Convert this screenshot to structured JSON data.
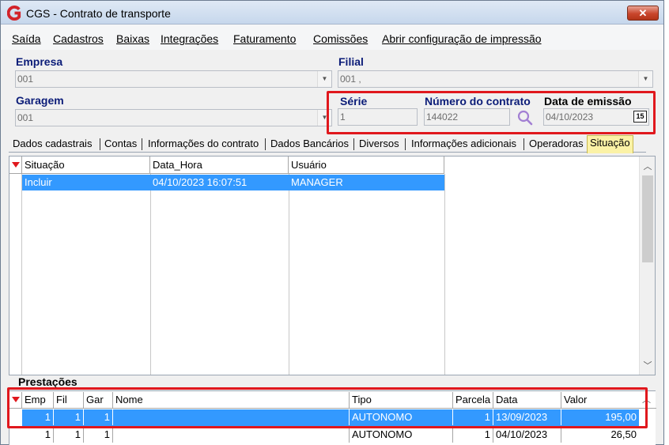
{
  "window": {
    "title": "CGS - Contrato de transporte",
    "close_label": "✕"
  },
  "menu": [
    "Saída",
    "Cadastros",
    "Baixas",
    "Integrações",
    "Faturamento",
    "Comissões",
    "Abrir configuração de impressão"
  ],
  "form": {
    "empresa_label": "Empresa",
    "empresa_value": "001",
    "filial_label": "Filial",
    "filial_value": "001 ,",
    "garagem_label": "Garagem",
    "garagem_value": "001",
    "serie_label": "Série",
    "serie_value": "1",
    "numero_label": "Número do contrato",
    "numero_value": "144022",
    "data_label": "Data de emissão",
    "data_value": "04/10/2023",
    "calendar_icon_text": "15"
  },
  "tabs": [
    "Dados cadastrais",
    "Contas",
    "Informações do contrato",
    "Dados Bancários",
    "Diversos",
    "Informações adicionais",
    "Operadoras",
    "Situação"
  ],
  "situacao_grid": {
    "headers": [
      "Situação",
      "Data_Hora",
      "Usuário"
    ],
    "rows": [
      [
        "Incluir",
        "04/10/2023 16:07:51",
        "MANAGER"
      ]
    ]
  },
  "prestacoes": {
    "label": "Prestações",
    "headers": [
      "Emp",
      "Fil",
      "Gar",
      "Nome",
      "Tipo",
      "Parcela",
      "Data",
      "Valor"
    ],
    "rows": [
      [
        "1",
        "1",
        "1",
        "",
        "AUTONOMO",
        "1",
        "13/09/2023",
        "195,00"
      ],
      [
        "1",
        "1",
        "1",
        "",
        "AUTONOMO",
        "1",
        "04/10/2023",
        "26,50"
      ]
    ]
  },
  "colors": {
    "selection": "#3399ff",
    "highlight_box": "#e0181d",
    "label_blue": "#0b1c78",
    "active_tab": "#fbf2a6"
  }
}
